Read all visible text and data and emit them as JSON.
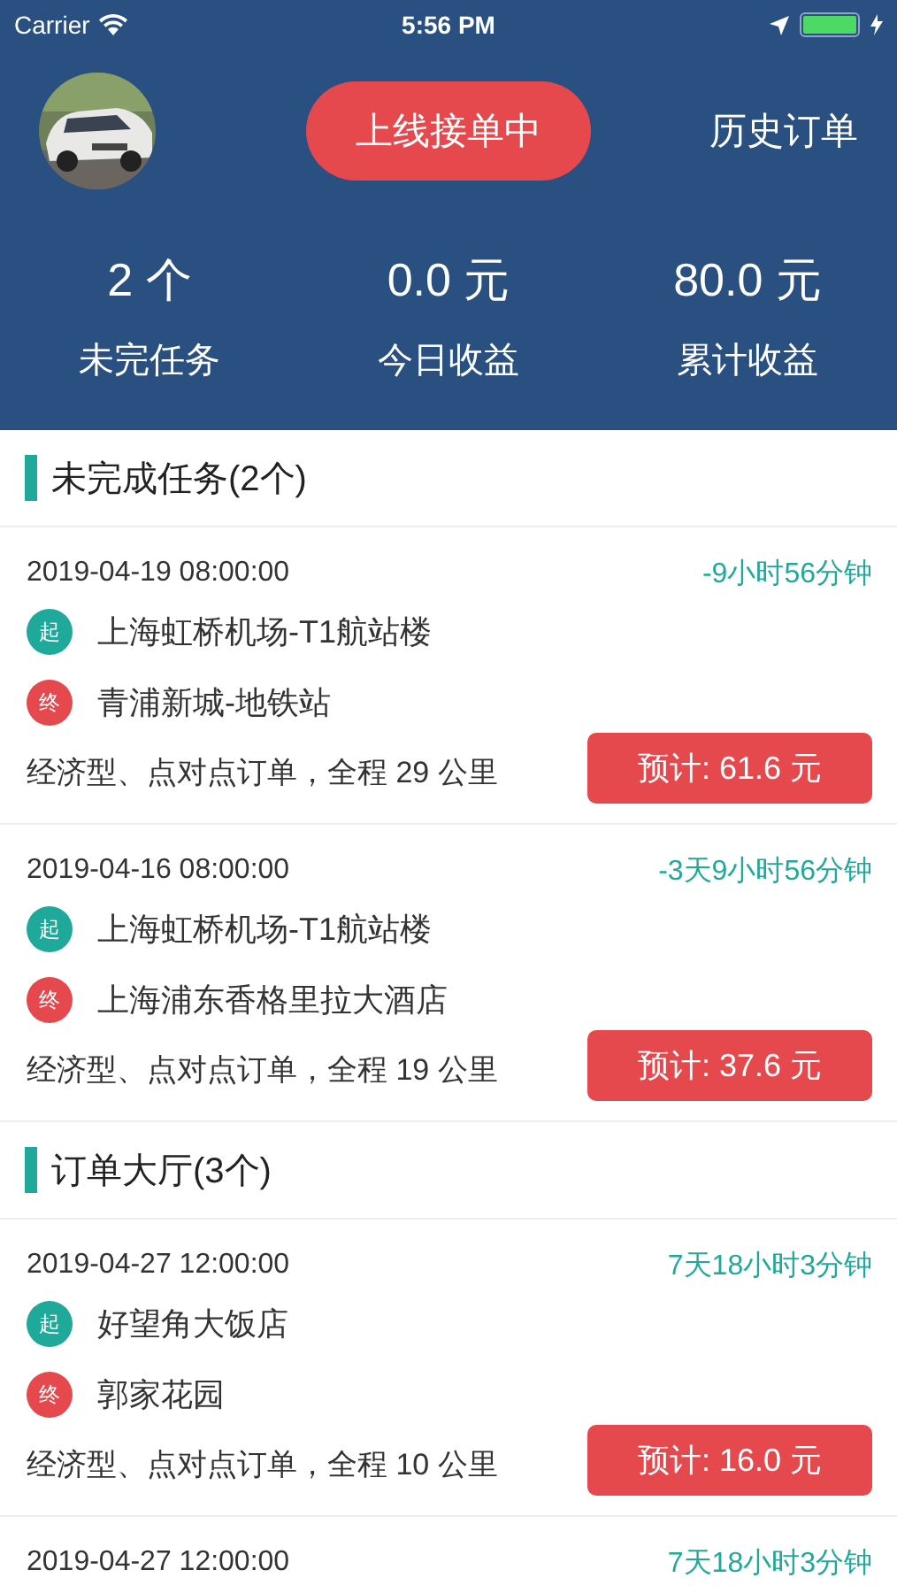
{
  "status_bar": {
    "carrier": "Carrier",
    "time": "5:56 PM"
  },
  "header": {
    "online_button": "上线接单中",
    "history_link": "历史订单",
    "stats": [
      {
        "value": "2 个",
        "label": "未完任务"
      },
      {
        "value": "0.0 元",
        "label": "今日收益"
      },
      {
        "value": "80.0 元",
        "label": "累计收益"
      }
    ]
  },
  "sections": [
    {
      "title": "未完成任务(2个)",
      "orders": [
        {
          "datetime": "2019-04-19 08:00:00",
          "countdown": "-9小时56分钟",
          "stops": [
            {
              "kind": "start",
              "marker": "起",
              "place": "上海虹桥机场-T1航站楼"
            },
            {
              "kind": "end",
              "marker": "终",
              "place": "青浦新城-地铁站"
            }
          ],
          "description": "经济型、点对点订单，全程 29 公里",
          "estimate": "预计: 61.6 元"
        },
        {
          "datetime": "2019-04-16 08:00:00",
          "countdown": "-3天9小时56分钟",
          "stops": [
            {
              "kind": "start",
              "marker": "起",
              "place": "上海虹桥机场-T1航站楼"
            },
            {
              "kind": "end",
              "marker": "终",
              "place": "上海浦东香格里拉大酒店"
            }
          ],
          "description": "经济型、点对点订单，全程 19 公里",
          "estimate": "预计: 37.6 元"
        }
      ]
    },
    {
      "title": "订单大厅(3个)",
      "orders": [
        {
          "datetime": "2019-04-27 12:00:00",
          "countdown": "7天18小时3分钟",
          "stops": [
            {
              "kind": "start",
              "marker": "起",
              "place": "好望角大饭店"
            },
            {
              "kind": "end",
              "marker": "终",
              "place": "郭家花园"
            }
          ],
          "description": "经济型、点对点订单，全程 10 公里",
          "estimate": "预计: 16.0 元"
        },
        {
          "datetime": "2019-04-27 12:00:00",
          "countdown": "7天18小时3分钟"
        }
      ]
    }
  ]
}
